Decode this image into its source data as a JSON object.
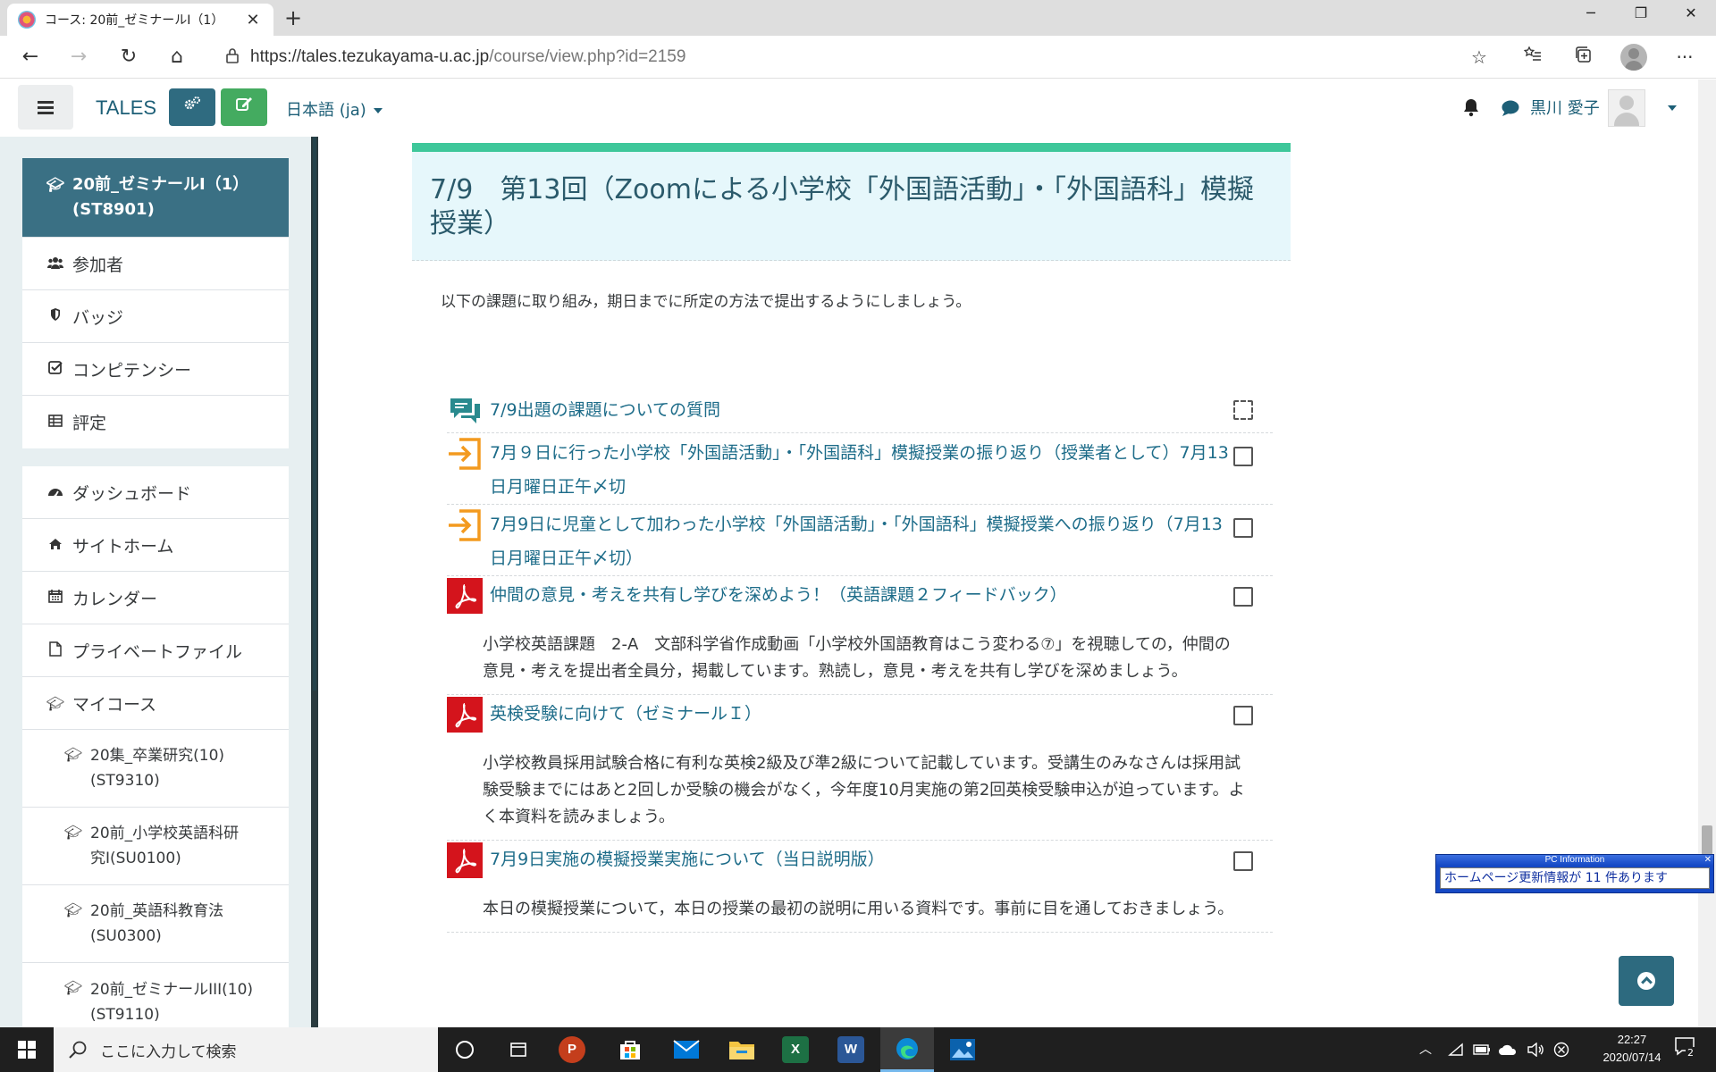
{
  "browser": {
    "tab_title": "コース: 20前_ゼミナールI（1）",
    "url_host": "https://tales.tezukayama-u.ac.jp",
    "url_path": "/course/view.php?id=2159",
    "icons": [
      "back-icon",
      "forward-icon",
      "refresh-icon",
      "home-icon",
      "lock-icon",
      "star-icon",
      "favorites-icon",
      "collections-icon",
      "profile-icon",
      "more-icon"
    ]
  },
  "navbar": {
    "brand": "TALES",
    "language": "日本語 (ja)",
    "user_name": "黒川 愛子"
  },
  "drawer": {
    "course": {
      "title": "20前_ゼミナールI（1）",
      "code": "(ST8901)"
    },
    "course_items": [
      {
        "label": "参加者",
        "icon": "users-icon"
      },
      {
        "label": "バッジ",
        "icon": "shield-icon"
      },
      {
        "label": "コンピテンシー",
        "icon": "checkbox-icon"
      },
      {
        "label": "評定",
        "icon": "table-icon"
      }
    ],
    "site_items": [
      {
        "label": "ダッシュボード",
        "icon": "dashboard-icon"
      },
      {
        "label": "サイトホーム",
        "icon": "home-icon"
      },
      {
        "label": "カレンダー",
        "icon": "calendar-icon"
      },
      {
        "label": "プライベートファイル",
        "icon": "file-icon"
      },
      {
        "label": "マイコース",
        "icon": "graduation-cap-icon"
      }
    ],
    "my_courses": [
      {
        "line1": "20集_卒業研究(10)",
        "line2": "(ST9310)"
      },
      {
        "line1": "20前_小学校英語科研",
        "line2": "究I(SU0100)"
      },
      {
        "line1": "20前_英語科教育法",
        "line2": "(SU0300)"
      },
      {
        "line1": "20前_ゼミナールIII(10)",
        "line2": "(ST9110)"
      }
    ]
  },
  "section": {
    "title": "7/9　第13回（Zoomによる小学校「外国語活動」・「外国語科」模擬授業）",
    "intro": "以下の課題に取り組み，期日までに所定の方法で提出するようにしましょう。"
  },
  "activities": [
    {
      "type": "forum",
      "title": "7/9出題の課題についての質問",
      "description": "",
      "completion": "auto"
    },
    {
      "type": "assign",
      "title": "7月９日に行った小学校「外国語活動」・「外国語科」模擬授業の振り返り（授業者として）7月13日月曜日正午〆切",
      "description": "",
      "completion": "manual"
    },
    {
      "type": "assign",
      "title": "7月9日に児童として加わった小学校「外国語活動」・「外国語科」模擬授業への振り返り（7月13日月曜日正午〆切）",
      "description": "",
      "completion": "manual"
    },
    {
      "type": "pdf",
      "title": "仲間の意見・考えを共有し学びを深めよう！（英語課題２フィードバック）",
      "description": "小学校英語課題　2-A　文部科学省作成動画「小学校外国語教育はこう変わる⑦」を視聴しての，仲間の意見・考えを提出者全員分，掲載しています。熟読し，意見・考えを共有し学びを深めましょう。",
      "completion": "manual"
    },
    {
      "type": "pdf",
      "title": "英検受験に向けて（ゼミナールＩ）",
      "description": "小学校教員採用試験合格に有利な英検2級及び準2級について記載しています。受講生のみなさんは採用試験受験までにはあと2回しか受験の機会がなく，今年度10月実施の第2回英検受験申込が迫っています。よく本資料を読みましょう。",
      "completion": "manual"
    },
    {
      "type": "pdf",
      "title": "7月9日実施の模擬授業実施について（当日説明版）",
      "description": "本日の模擬授業について，本日の授業の最初の説明に用いる資料です。事前に目を通しておきましょう。",
      "completion": "manual"
    }
  ],
  "popup": {
    "title": "PC Information",
    "message": "ホームページ更新情報が 11 件あります"
  },
  "taskbar": {
    "search_placeholder": "ここに入力して検索",
    "time": "22:27",
    "date": "2020/07/14",
    "notifications": "2",
    "apps": [
      "cortana-icon",
      "task-view-icon",
      "powerpoint-icon",
      "store-icon",
      "mail-icon",
      "file-explorer-icon",
      "excel-icon",
      "word-icon",
      "edge-icon",
      "photos-icon"
    ]
  },
  "colors": {
    "brand": "#1d5f77",
    "course_header": "#3a7084",
    "section_bar": "#3ec79a",
    "section_bg": "#e6f7fb",
    "link": "#1d6c89",
    "pdf_red": "#d4141c",
    "assign_orange": "#f39a1f",
    "forum_teal": "#2a8a8e"
  }
}
